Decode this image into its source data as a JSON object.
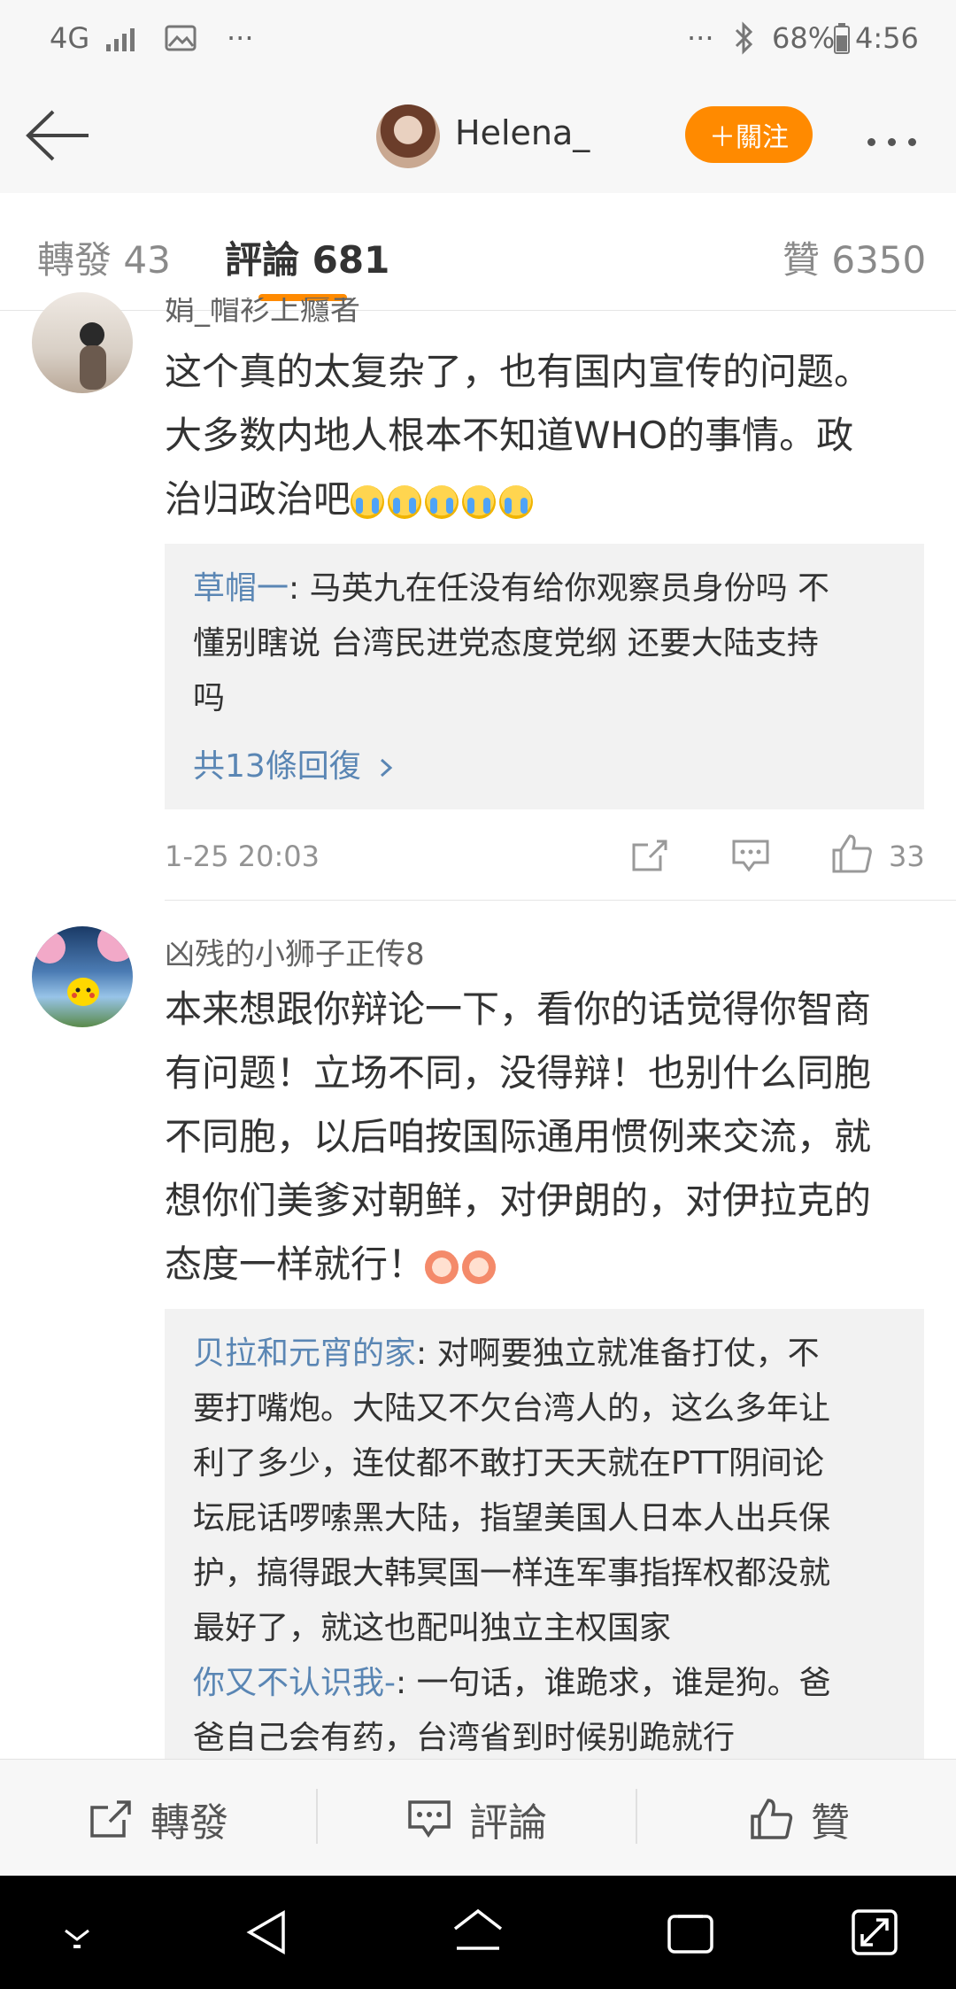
{
  "status_bar": {
    "network": "4G",
    "battery": "68%",
    "time": "4:56",
    "more": "···"
  },
  "header": {
    "username": "Helena_",
    "follow_label": "＋關注"
  },
  "tabs": [
    {
      "label": "轉發 43"
    },
    {
      "label": "評論 681"
    },
    {
      "label": "贊 6350"
    }
  ],
  "comments": [
    {
      "name": "娟_帽衫上癮者",
      "text_lines": [
        "这个真的太复杂了，也有国内宣传的问题。",
        "大多数内地人根本不知道WHO的事情。政",
        "治归政治吧"
      ],
      "emoji": [
        "crying-face",
        "crying-face",
        "crying-face",
        "crying-face",
        "crying-face"
      ],
      "reply": {
        "user": "草帽一",
        "lines": [
          ": 马英九在任没有给你观察员身份吗 不",
          "懂别瞎说 台湾民进党态度党纲 还要大陆支持",
          "吗"
        ],
        "more": "共13條回復"
      },
      "time": "1-25 20:03",
      "likes": "33"
    },
    {
      "name": "凶残的小狮子正传8",
      "text_lines": [
        "本来想跟你辩论一下，看你的话觉得你智商",
        "有问题！立场不同，没得辩！也别什么同胞",
        "不同胞，以后咱按国际通用惯例来交流，就",
        "想你们美爹对朝鲜，对伊朗的，对伊拉克的",
        "态度一样就行！"
      ],
      "emoji": [
        "angry-face",
        "angry-face"
      ],
      "replies": [
        {
          "user": "贝拉和元宵的家",
          "lines": [
            ": 对啊要独立就准备打仗，不",
            "要打嘴炮。大陆又不欠台湾人的，这么多年让",
            "利了多少，连仗都不敢打天天就在PTT阴间论",
            "坛屁话啰嗦黑大陆，指望美国人日本人出兵保",
            "护，搞得跟大韩冥国一样连军事指挥权都没就",
            "最好了，就这也配叫独立主权国家"
          ]
        },
        {
          "user": "你又不认识我-",
          "lines": [
            ": 一句话，谁跪求，谁是狗。爸",
            "爸自己会有药，台湾省到时候别跪就行"
          ]
        }
      ]
    }
  ],
  "bottom_bar": {
    "repost": "轉發",
    "comment": "評論",
    "like": "贊"
  }
}
